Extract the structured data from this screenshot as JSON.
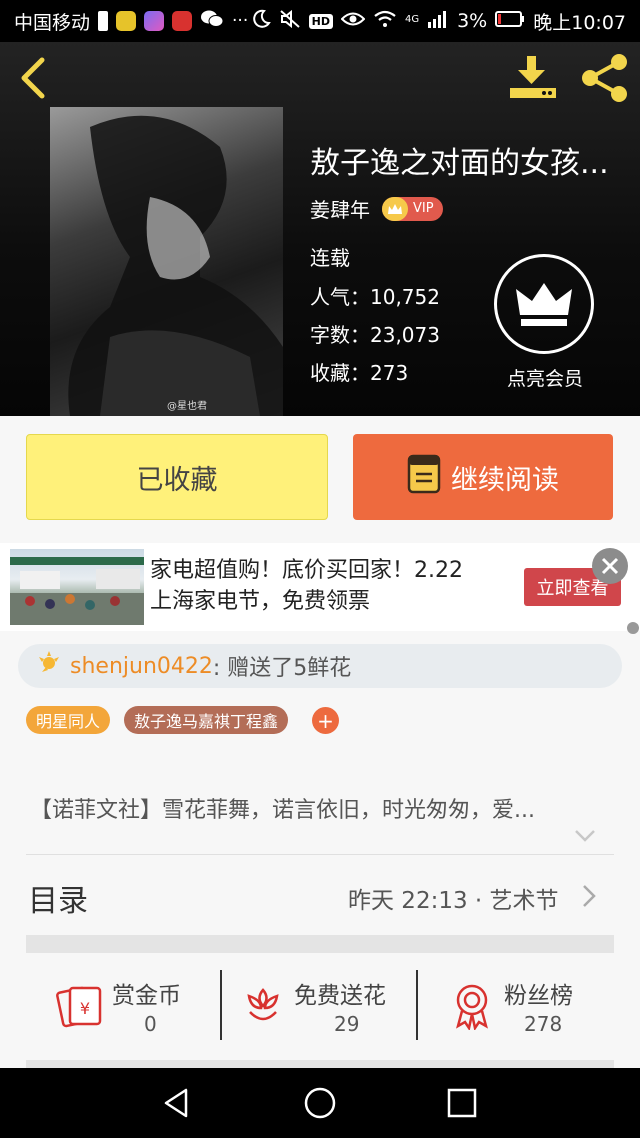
{
  "status_bar": {
    "carrier": "中国移动",
    "more": "···",
    "hd": "HD",
    "network": "4G",
    "battery": "3%",
    "time": "晚上10:07"
  },
  "book": {
    "title": "敖子逸之对面的女孩...",
    "author": "姜肆年",
    "vip": "VIP",
    "status": "连载",
    "popularity_label": "人气：",
    "popularity": "10,752",
    "word_count_label": "字数：",
    "word_count": "23,073",
    "favorites_label": "收藏：",
    "favorites": "273",
    "cover_watermark": "@星也君",
    "member_label": "点亮会员"
  },
  "actions": {
    "favorited_label": "已收藏",
    "continue_label": "继续阅读"
  },
  "ad": {
    "line1": "家电超值购！底价买回家！2.22",
    "line2": "上海家电节，免费领票",
    "cta": "立即查看"
  },
  "gift": {
    "user": "shenjun0422",
    "action": " : 赠送了5鲜花"
  },
  "tags": [
    "明星同人",
    "敖子逸马嘉祺丁程鑫"
  ],
  "add_tag": "+",
  "description": "【诺菲文社】雪花菲舞，诺言依旧，时光匆匆，爱...",
  "toc": {
    "title": "目录",
    "latest": "昨天 22:13 · 艺术节"
  },
  "stats": [
    {
      "label": "赏金币",
      "value": "0"
    },
    {
      "label": "免费送花",
      "value": "29"
    },
    {
      "label": "粉丝榜",
      "value": "278"
    }
  ],
  "colors": {
    "accent_orange": "#ee6a3e",
    "fav_yellow": "#fff17a",
    "gift_user": "#ed8c26",
    "icon_red": "#d8322f"
  }
}
